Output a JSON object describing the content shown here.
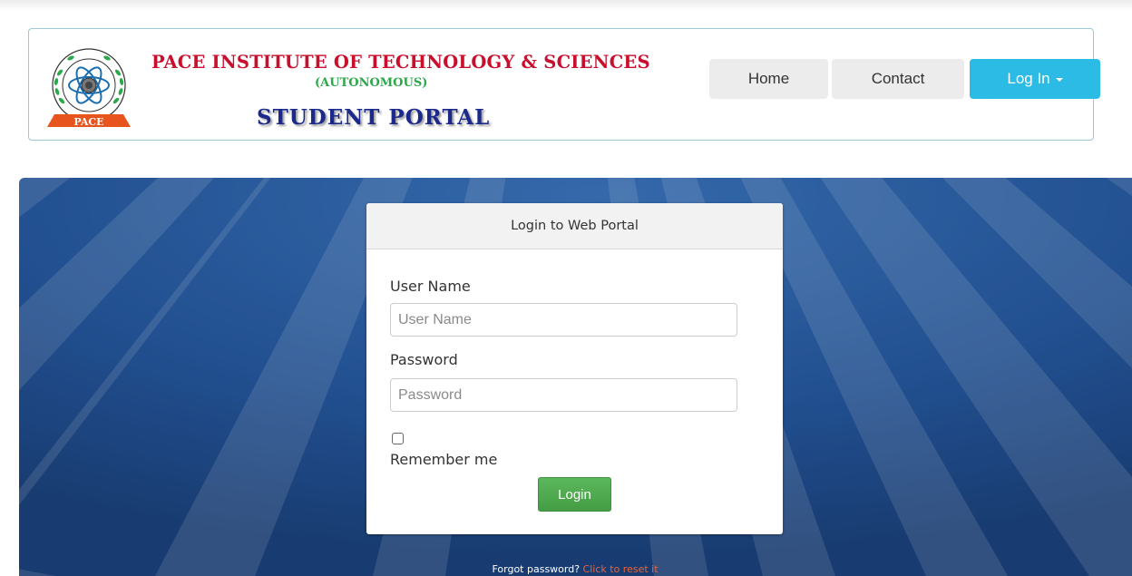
{
  "header": {
    "institute_name": "PACE INSTITUTE OF TECHNOLOGY & SCIENCES",
    "autonomous": "(AUTONOMOUS)",
    "portal_title": "STUDENT PORTAL",
    "logo_text": "PACE"
  },
  "nav": {
    "home": "Home",
    "contact": "Contact",
    "login": "Log In"
  },
  "login_card": {
    "title": "Login to Web Portal",
    "username_label": "User Name",
    "username_placeholder": "User Name",
    "username_value": "",
    "password_label": "Password",
    "password_placeholder": "Password",
    "password_value": "",
    "remember_label": "Remember me",
    "remember_checked": false,
    "submit_label": "Login"
  },
  "footer": {
    "forgot_text": "Forgot password?",
    "reset_link": "Click to reset it"
  },
  "colors": {
    "brand_red": "#c8102e",
    "brand_green": "#2aa84a",
    "brand_navy": "#1b2a8a",
    "login_blue": "#2bbbe5",
    "submit_green": "#5cb85c",
    "hero_blue": "#1e4f8e",
    "link_orange": "#e8643a"
  },
  "icons": {
    "logo": "pace-emblem-icon",
    "caret": "caret-down-icon"
  }
}
